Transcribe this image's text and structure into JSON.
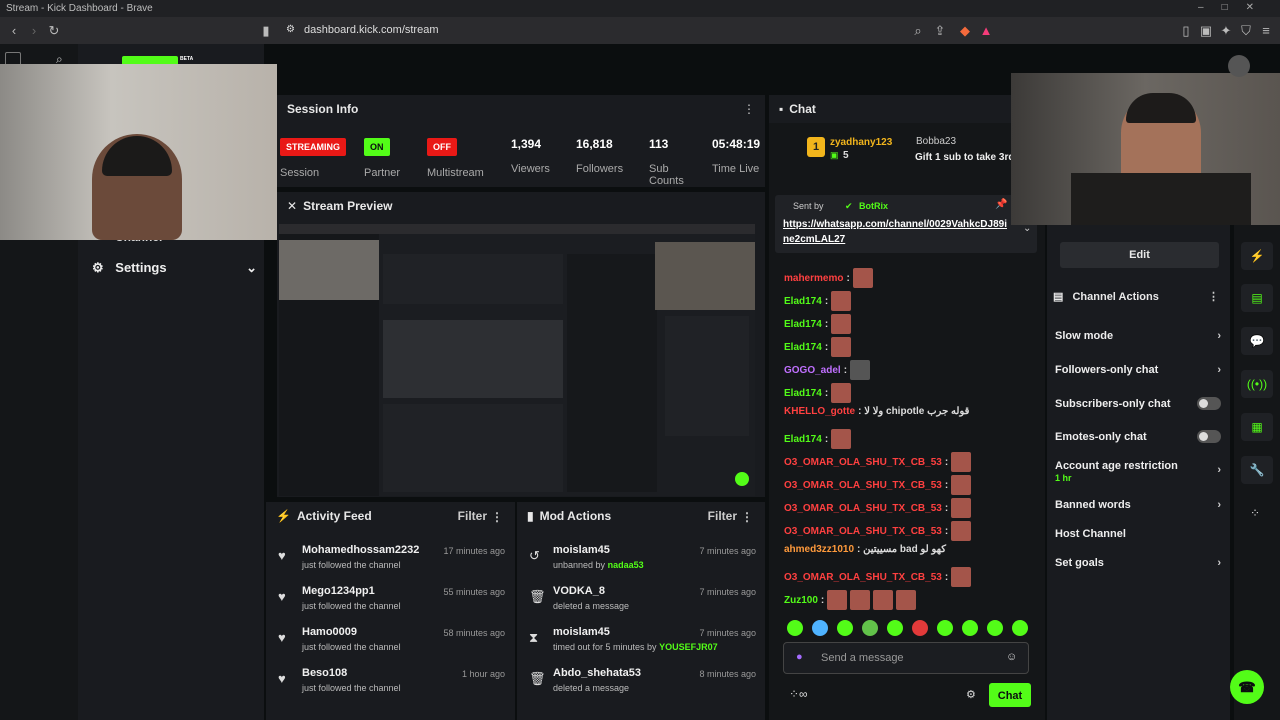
{
  "window": {
    "title": "Stream - Kick Dashboard - Brave"
  },
  "browser": {
    "url": "dashboard.kick.com/stream"
  },
  "brand": {
    "beta": "BETA"
  },
  "sidebar": {
    "items": [
      {
        "label": "Channel"
      },
      {
        "label": "Settings"
      }
    ]
  },
  "session": {
    "title": "Session Info",
    "badges": [
      {
        "text": "STREAMING",
        "label": "Session"
      },
      {
        "text": "ON",
        "label": "Partner"
      },
      {
        "text": "OFF",
        "label": "Multistream"
      }
    ],
    "stats": [
      {
        "value": "1,394",
        "label": "Viewers"
      },
      {
        "value": "16,818",
        "label": "Followers"
      },
      {
        "value": "113",
        "label": "Sub Counts"
      },
      {
        "value": "05:48:19",
        "label": "Time Live"
      }
    ]
  },
  "preview": {
    "title": "Stream Preview"
  },
  "activity": {
    "title": "Activity Feed",
    "filter": "Filter",
    "items": [
      {
        "name": "Mohamedhossam2232",
        "action": "just followed the channel",
        "time": "17 minutes ago"
      },
      {
        "name": "Mego1234pp1",
        "action": "just followed the channel",
        "time": "55 minutes ago"
      },
      {
        "name": "Hamo0009",
        "action": "just followed the channel",
        "time": "58 minutes ago"
      },
      {
        "name": "Beso108",
        "action": "just followed the channel",
        "time": "1 hour ago"
      }
    ]
  },
  "mod": {
    "title": "Mod Actions",
    "filter": "Filter",
    "items": [
      {
        "name": "moislam45",
        "action": "unbanned by",
        "target": "nadaa53",
        "time": "7 minutes ago"
      },
      {
        "name": "VODKA_8",
        "action": "deleted a message",
        "target": "",
        "time": "7 minutes ago"
      },
      {
        "name": "moislam45",
        "action": "timed out for 5 minutes by",
        "target": "YOUSEFJR07",
        "time": "7 minutes ago"
      },
      {
        "name": "Abdo_shehata53",
        "action": "deleted a message",
        "target": "",
        "time": "8 minutes ago"
      }
    ]
  },
  "chat": {
    "title": "Chat",
    "top_gifter": {
      "name": "zyadhany123",
      "count": "5"
    },
    "gift": {
      "name": "Bobba23",
      "text": "Gift 1 sub to take 3rd"
    },
    "pinned": {
      "sent_by": "Sent by",
      "user": "BotRix",
      "link": "https://whatsapp.com/channel/0029VahkcDJ89ine2cmLAL27"
    },
    "messages": [
      {
        "user": "mahermemo",
        "text": ":",
        "color": "#ff4040"
      },
      {
        "user": "Elad174",
        "text": ":",
        "color": "#53fc18"
      },
      {
        "user": "Elad174",
        "text": ":",
        "color": "#53fc18"
      },
      {
        "user": "Elad174",
        "text": ":",
        "color": "#53fc18"
      },
      {
        "user": "GOGO_adel",
        "text": ":",
        "color": "#c070ff"
      },
      {
        "user": "Elad174",
        "text": ":",
        "color": "#53fc18"
      },
      {
        "user": "KHELLO_gotte",
        "text": ": ولا لا chipotle قوله جرب",
        "color": "#ff4040"
      },
      {
        "user": "Elad174",
        "text": ":",
        "color": "#53fc18"
      },
      {
        "user": "O3_OMAR_OLA_SHU_TX_CB_53",
        "text": ":",
        "color": "#ff4040"
      },
      {
        "user": "O3_OMAR_OLA_SHU_TX_CB_53",
        "text": ":",
        "color": "#ff4040"
      },
      {
        "user": "O3_OMAR_OLA_SHU_TX_CB_53",
        "text": ":",
        "color": "#ff4040"
      },
      {
        "user": "O3_OMAR_OLA_SHU_TX_CB_53",
        "text": ":",
        "color": "#ff4040"
      },
      {
        "user": "ahmed3zz1010",
        "text": ": مسييتين bad كهو لو",
        "color": "#ff9a3c"
      },
      {
        "user": "O3_OMAR_OLA_SHU_TX_CB_53",
        "text": ":",
        "color": "#ff4040"
      },
      {
        "user": "Zuz100",
        "text": ":",
        "color": "#53fc18"
      }
    ],
    "placeholder": "Send a message",
    "send": "Chat"
  },
  "edit": {
    "label": "Edit"
  },
  "channel_actions": {
    "title": "Channel Actions",
    "items": [
      {
        "label": "Slow mode",
        "kind": "chevron"
      },
      {
        "label": "Followers-only chat",
        "kind": "chevron"
      },
      {
        "label": "Subscribers-only chat",
        "kind": "toggle"
      },
      {
        "label": "Emotes-only chat",
        "kind": "toggle"
      },
      {
        "label": "Account age restriction",
        "sub": "1 hr",
        "kind": "chevron"
      },
      {
        "label": "Banned words",
        "kind": "chevron"
      },
      {
        "label": "Host Channel",
        "kind": "none"
      },
      {
        "label": "Set goals",
        "kind": "chevron"
      }
    ]
  },
  "colors": {
    "accent": "#53fc18",
    "streaming": "#e91916",
    "panel": "#191b1f"
  }
}
